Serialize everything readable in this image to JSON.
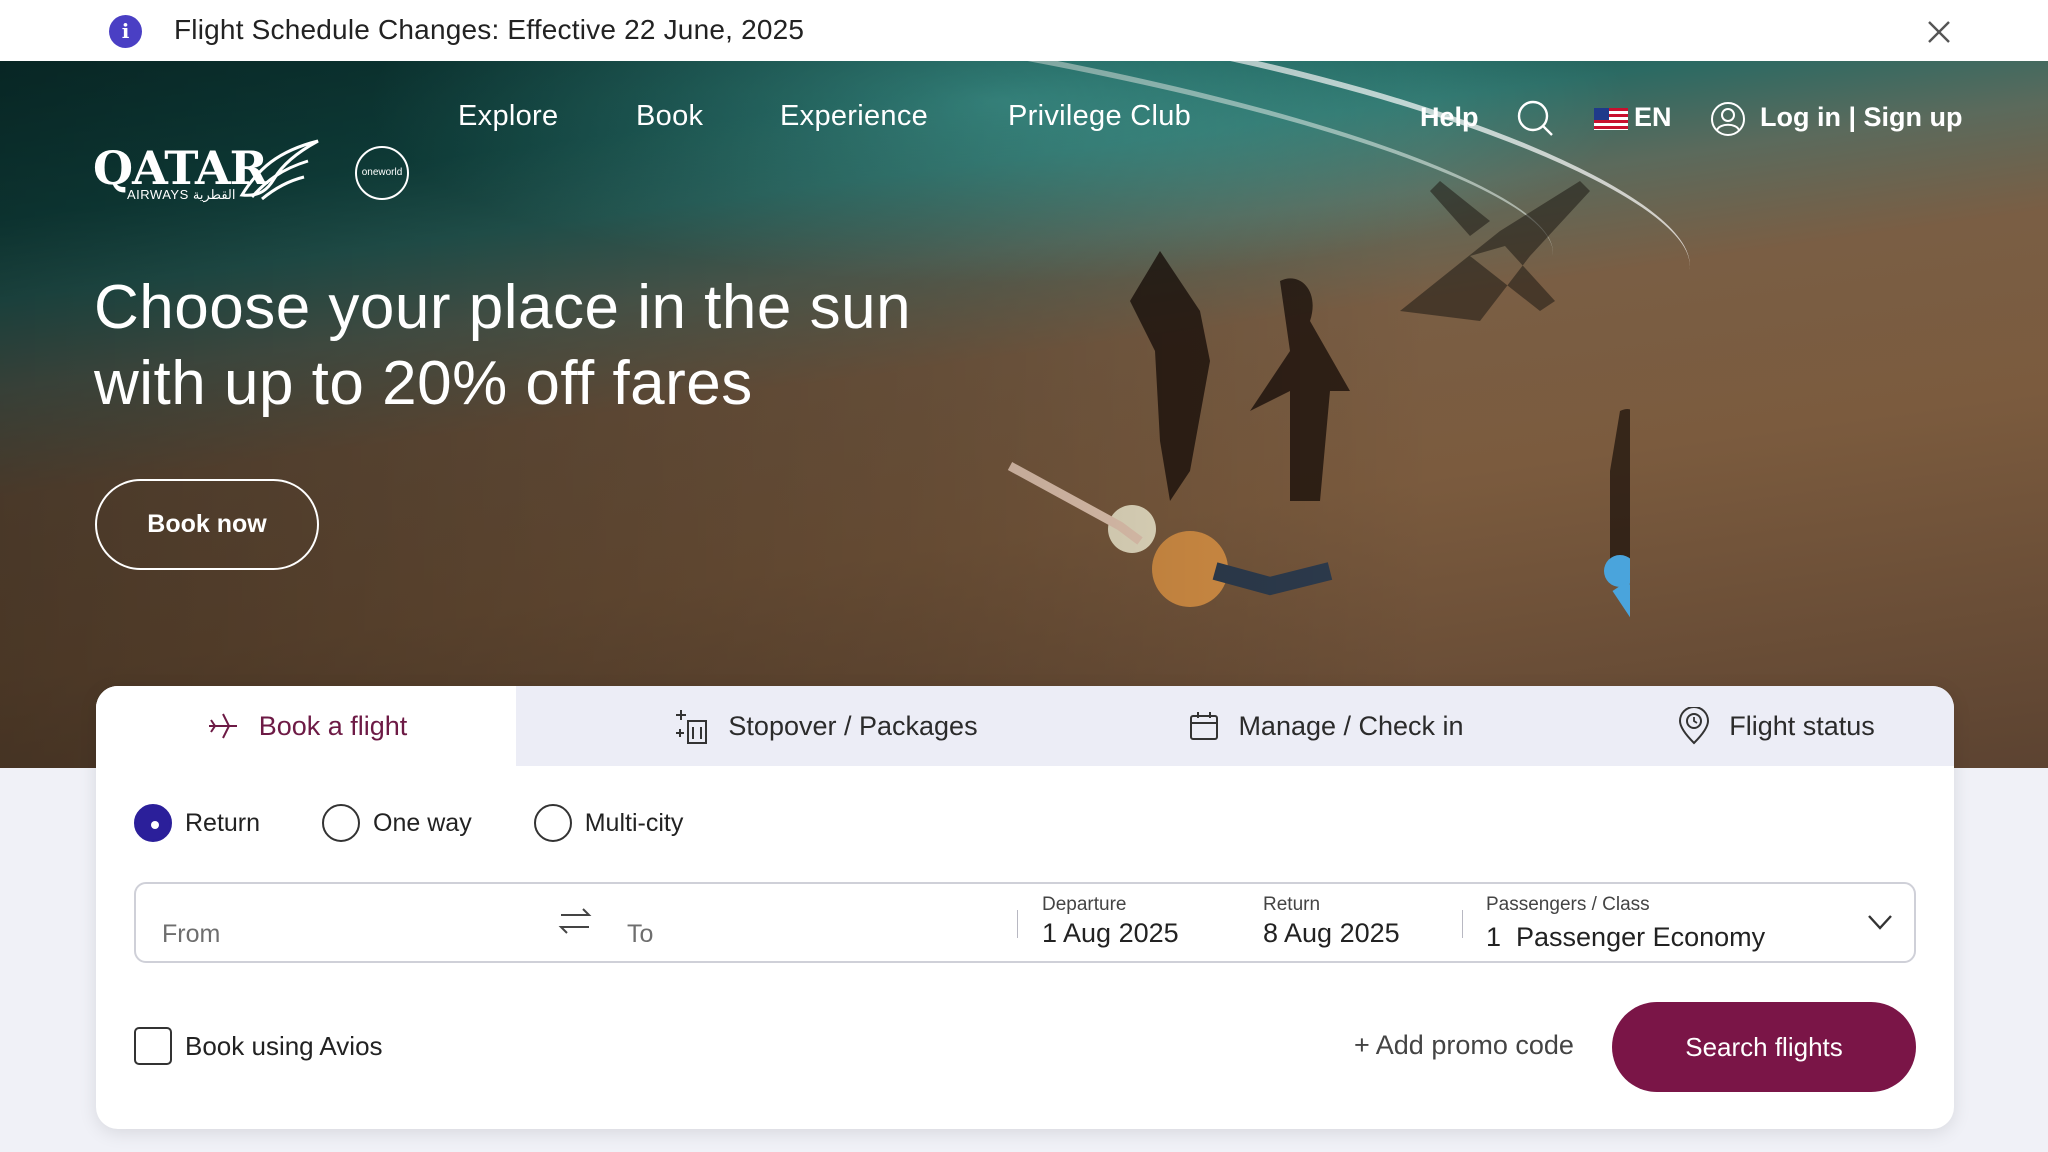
{
  "notice": {
    "text": "Flight Schedule Changes: Effective 22 June, 2025",
    "icon": "info-icon",
    "close_icon": "close-icon"
  },
  "brand": {
    "logo_main": "QATAR",
    "logo_sub": "AIRWAYS القطرية",
    "alliance": "oneworld"
  },
  "nav": {
    "links": [
      "Explore",
      "Book",
      "Experience",
      "Privilege Club"
    ],
    "help": "Help",
    "language": "EN",
    "login": "Log in | Sign up"
  },
  "hero": {
    "headline_line1": "Choose your place in the sun",
    "headline_line2": "with up to 20% off fares",
    "cta": "Book now"
  },
  "booking": {
    "tabs": [
      {
        "label": "Book a flight",
        "icon": "plane-icon"
      },
      {
        "label": "Stopover / Packages",
        "icon": "hotel-luggage-icon"
      },
      {
        "label": "Manage / Check in",
        "icon": "calendar-icon"
      },
      {
        "label": "Flight status",
        "icon": "location-pin-icon"
      }
    ],
    "trip_types": [
      "Return",
      "One way",
      "Multi-city"
    ],
    "selected_trip_type": "Return",
    "from_placeholder": "From",
    "to_placeholder": "To",
    "departure_label": "Departure",
    "departure_value": "1 Aug 2025",
    "return_label": "Return",
    "return_value": "8 Aug 2025",
    "passengers_label": "Passengers / Class",
    "passengers_value": "1  Passenger Economy",
    "avios_label": "Book using Avios",
    "promo_label": "+ Add promo code",
    "search_label": "Search flights"
  },
  "colors": {
    "accent": "#7a1547",
    "radio_selected": "#2b1f9a",
    "info_icon": "#4a3fc4"
  }
}
